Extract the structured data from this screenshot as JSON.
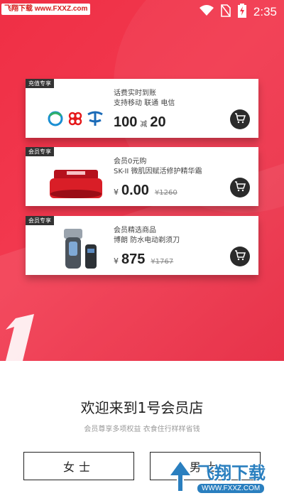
{
  "status_bar": {
    "watermark": "飞翔下载 www.FXXZ.com",
    "time": "2:35"
  },
  "cards": [
    {
      "badge": "充值专享",
      "line1": "话费实时到账",
      "line2": "支持移动 联通 电信",
      "price_main": "100",
      "price_mid": "减",
      "price_tail": "20",
      "logos": [
        "china-mobile-logo",
        "china-unicom-logo",
        "china-telecom-logo"
      ]
    },
    {
      "badge": "会员专享",
      "line1": "会员0元购",
      "line2": "SK-II 微肌因赋活修护精华霜",
      "yen": "¥",
      "price_main": "0.00",
      "old_price": "¥1260",
      "image": "red-cream-jar"
    },
    {
      "badge": "会员专享",
      "line1": "会员精选商品",
      "line2": "博朗 防水电动剃须刀",
      "yen": "¥",
      "price_main": "875",
      "old_price": "¥1767",
      "image": "electric-shaver"
    }
  ],
  "welcome": {
    "title": "欢迎来到1号会员店",
    "subtitle": "会员尊享多项权益 衣食住行样样省钱"
  },
  "buttons": {
    "female": "女士",
    "male": "男士"
  },
  "watermark_bottom": {
    "text": "飞翔下载",
    "url": "WWW.FXXZ.COM"
  },
  "colors": {
    "hero": "#ef2f45",
    "cart": "#2b2b2b",
    "watermark_blue": "#2a7fbf"
  }
}
